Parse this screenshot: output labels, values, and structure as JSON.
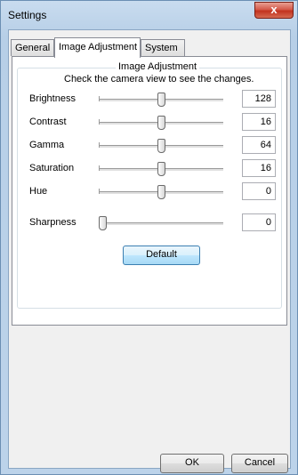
{
  "window": {
    "title": "Settings",
    "close_label": "x"
  },
  "tabs": [
    {
      "label": "General",
      "active": false
    },
    {
      "label": "Image Adjustment",
      "active": true
    },
    {
      "label": "System",
      "active": false
    }
  ],
  "panel": {
    "group_title": "Image Adjustment",
    "hint": "Check the camera view to see the changes.",
    "sliders": [
      {
        "label": "Brightness",
        "value": "128",
        "level": 0.5
      },
      {
        "label": "Contrast",
        "value": "16",
        "level": 0.5
      },
      {
        "label": "Gamma",
        "value": "64",
        "level": 0.5
      },
      {
        "label": "Saturation",
        "value": "16",
        "level": 0.5
      },
      {
        "label": "Hue",
        "value": "0",
        "level": 0.5
      },
      {
        "label": "Sharpness",
        "value": "0",
        "level": 0.0
      }
    ],
    "default_label": "Default"
  },
  "footer": {
    "ok_label": "OK",
    "cancel_label": "Cancel"
  },
  "colors": {
    "title_bar": "#bcd3ea",
    "close_button": "#c2321f",
    "default_button_border": "#3c7fb1"
  }
}
